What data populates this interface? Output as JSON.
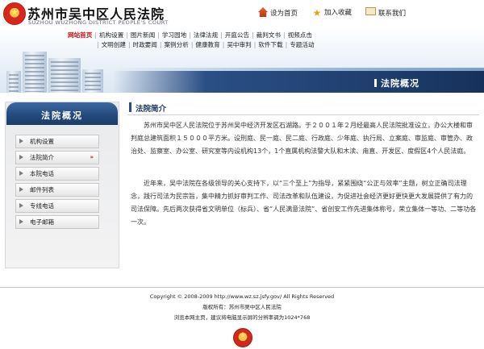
{
  "header": {
    "title": "苏州市吴中区人民法院",
    "subtitle": "SUZHOU WUZHONG DISTRICT PEOPLE'S COURT",
    "toplinks": [
      {
        "label": "设为首页",
        "icon": "home-icon"
      },
      {
        "label": "加入收藏",
        "icon": "star-icon"
      },
      {
        "label": "联系我们",
        "icon": "mail-icon"
      }
    ],
    "nav_row1": [
      "网站首页",
      "机构设置",
      "图片新闻",
      "学习园地",
      "法律法规",
      "开庭公告",
      "裁判文书",
      "视频点击"
    ],
    "nav_row2": [
      "文明创建",
      "时政要闻",
      "案例分析",
      "健康教育",
      "吴中审判",
      "软件下载",
      "专题活动"
    ],
    "banner_label": "法院概况"
  },
  "sidebar": {
    "title": "法院概况",
    "items": [
      {
        "label": "机构设置"
      },
      {
        "label": "法院简介",
        "active": true
      },
      {
        "label": "本院电话"
      },
      {
        "label": "邮件列表"
      },
      {
        "label": "专线电话"
      },
      {
        "label": "电子邮箱"
      }
    ],
    "active_marker": "»"
  },
  "main": {
    "section_title": "法院简介",
    "para1": "苏州市吴中区人民法院位于苏州吴中经济开发区石湖路。于２００１年２月经最高人民法院批准设立，办公大楼和审判庭总建筑面积１５０００平方米。设刑庭、民一庭、民二庭、行政庭、少年庭、执行局、立案庭、审监庭、审管办、政治处、监察室、办公室、研究室等内设机构13个，1个直属机构法警大队和木渎、甪直、开发区、度假区4个人民法庭。",
    "para2": "近年来，吴中法院在各级领导的关心支持下，以“三个至上”为指导，紧紧围绕“公正与效率”主题，树立正确司法理念，践行司法为民宗旨，集中精力抓好审判工作、司法改革和队伍建设，为促进社会经济更好更快更大发展提供了有力的司法保障。先后两次获得省文明单位（标兵）、省“人民满意法院”、省创安工作先进集体称号，荣立集体一等功、二等功各一次。"
  },
  "footer": {
    "copyright": "Copyright © 2008-2009 http://www.wz.sz.jsfy.gov/ All Rights Reserved",
    "owner": "版权所有：苏州市吴中区人民法院",
    "hint": "浏览本网主页，建议将电脑显示屏的分辨率调为1024*768"
  },
  "colors": {
    "accent_blue": "#2a4f86",
    "active_red": "#c11111"
  }
}
